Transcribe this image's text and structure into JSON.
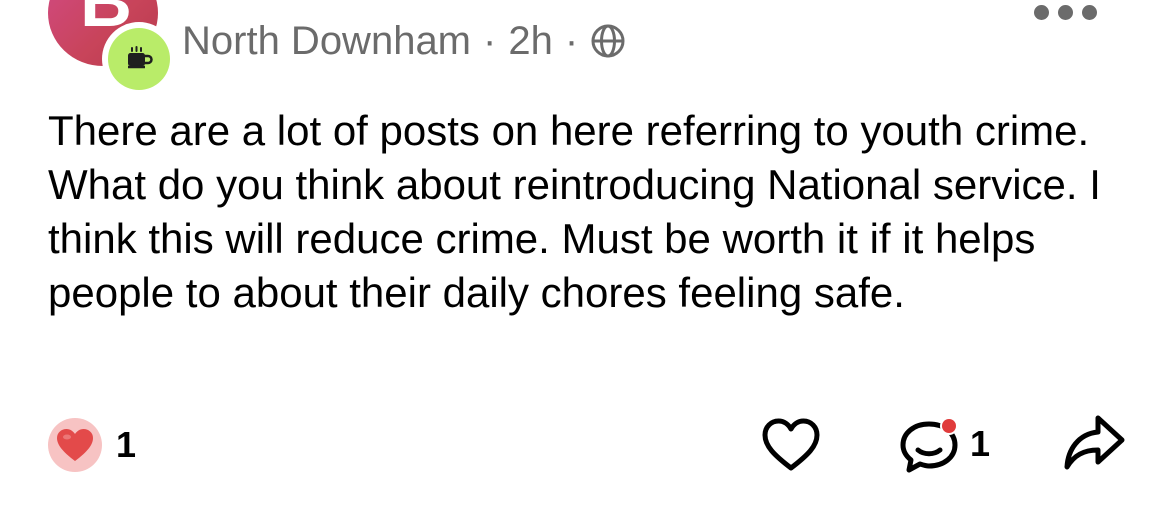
{
  "post": {
    "author_initial": "B",
    "group_name": "North Downham",
    "separator_1": "·",
    "time": "2h",
    "separator_2": "·",
    "visibility_icon": "globe-icon",
    "badge_icon": "coffee-cup-icon",
    "body": "There are a lot of posts on here referring to youth crime. What do you think about reintroducing National service. I think this will reduce crime. Must be worth it if it helps people to about their daily chores feeling safe."
  },
  "footer": {
    "reaction_icon": "heart-reaction-icon",
    "reaction_count": "1",
    "like_icon": "heart-outline-icon",
    "comment_icon": "comment-bubble-icon",
    "comment_count": "1",
    "share_icon": "share-arrow-icon"
  },
  "colors": {
    "avatar": "#c8445a",
    "badge": "#b9ec69",
    "meta_text": "#6b6b6b",
    "reaction_bubble": "#f7c3c3",
    "heart": "#e34a4a",
    "notification_dot": "#e03b3b"
  }
}
